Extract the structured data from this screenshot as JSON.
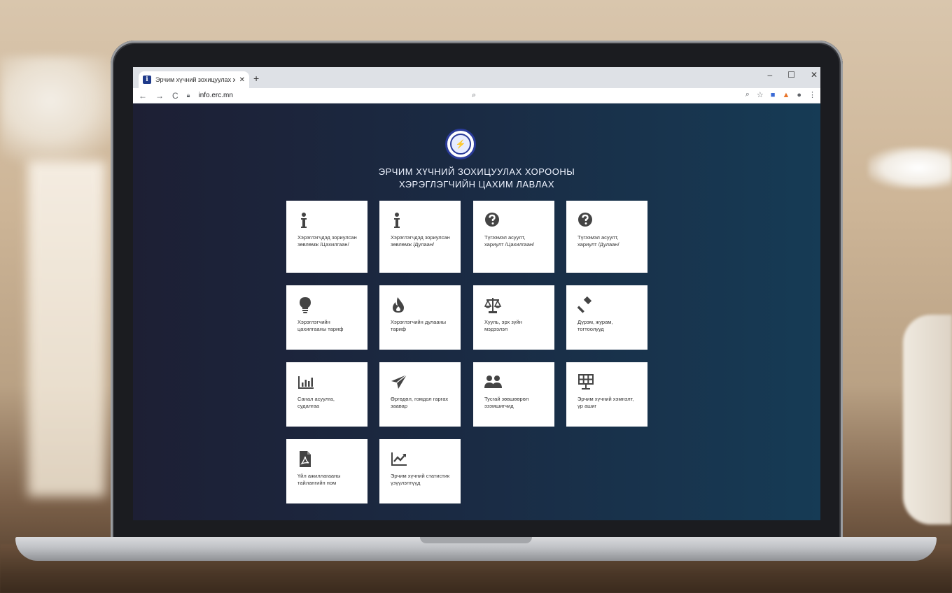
{
  "browser": {
    "tab_title": "Эрчим хүчний зохицуулах хорс",
    "tab_close": "✕",
    "new_tab": "+",
    "window_min": "–",
    "window_max": "☐",
    "window_close": "✕",
    "url": "info.erc.mn"
  },
  "page": {
    "title_line1": "ЭРЧИМ ХҮЧНИЙ ЗОХИЦУУЛАХ ХОРООНЫ",
    "title_line2": "ХЭРЭГЛЭГЧИЙН ЦАХИМ ЛАВЛАХ"
  },
  "cards": [
    {
      "icon": "info-icon",
      "label": "Хэрэглэгчдэд зориулсан зөвлөмж /Цахилгаан/"
    },
    {
      "icon": "info-icon",
      "label": "Хэрэглэгчдэд зориулсан зөвлөмж /Дулаан/"
    },
    {
      "icon": "question-circle-icon",
      "label": "Түгээмэл асуулт, хариулт /Цахилгаан/"
    },
    {
      "icon": "question-circle-icon",
      "label": "Түгээмэл асуулт, хариулт /Дулаан/"
    },
    {
      "icon": "lightbulb-icon",
      "label": "Хэрэглэгчийн цахилгааны тариф"
    },
    {
      "icon": "flame-icon",
      "label": "Хэрэглэгчийн дулааны тариф"
    },
    {
      "icon": "balance-scale-icon",
      "label": "Хууль, эрх зүйн мэдээлэл"
    },
    {
      "icon": "gavel-icon",
      "label": "Дүрэм, журам, тогтоолууд"
    },
    {
      "icon": "bar-chart-icon",
      "label": "Санал асуулга, судалгаа"
    },
    {
      "icon": "paper-plane-icon",
      "label": "Өргөдөл, гомдол гаргах заавар"
    },
    {
      "icon": "users-icon",
      "label": "Тусгай зөвшөөрөл эзэмшигчид"
    },
    {
      "icon": "solar-panel-icon",
      "label": "Эрчим хүчний хэмнэлт, үр ашиг"
    },
    {
      "icon": "pdf-file-icon",
      "label": "Үйл ажиллагааны тайлангийн ном"
    },
    {
      "icon": "line-chart-icon",
      "label": "Эрчим хүчний статистик үзүүлэлтүүд"
    }
  ]
}
